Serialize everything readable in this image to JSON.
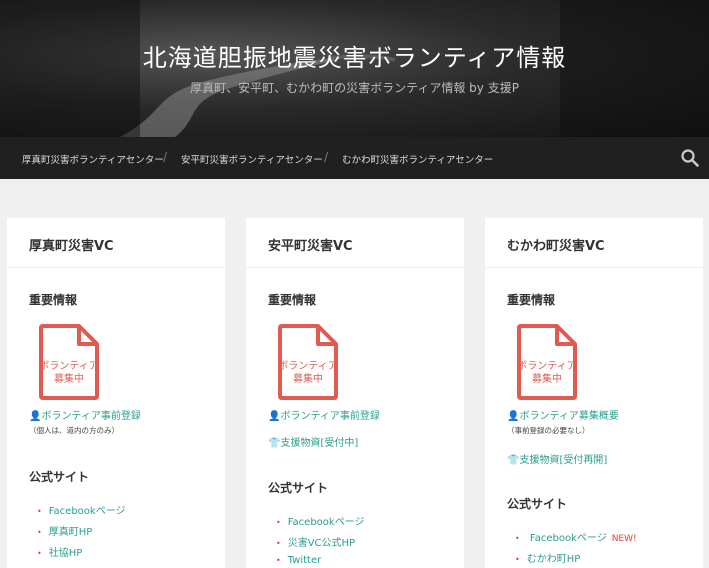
{
  "site": {
    "title": "北海道胆振地震災害ボランティア情報",
    "subtitle": "厚真町、安平町、むかわ町の災害ボランティア情報 by 支援P"
  },
  "nav": {
    "items": [
      "厚真町災害ボランティアセンター",
      "安平町災害ボランティアセンター",
      "むかわ町災害ボランティアセンター"
    ],
    "separator": "/"
  },
  "doc_icon_text": [
    "ボランティア",
    "募集中"
  ],
  "cards": [
    {
      "title": "厚真町災害VC",
      "important_heading": "重要情報",
      "register_link": "ボランティア事前登録",
      "register_note": "（個人は、道内の方のみ）",
      "official_heading": "公式サイト",
      "links": [
        "Facebookページ",
        "厚真町HP",
        "社協HP"
      ]
    },
    {
      "title": "安平町災害VC",
      "important_heading": "重要情報",
      "register_link": "ボランティア事前登録",
      "supplies_link": "支援物資[受付中]",
      "official_heading": "公式サイト",
      "links": [
        "Facebookページ",
        "災害VC公式HP",
        "Twitter"
      ]
    },
    {
      "title": "むかわ町災害VC",
      "important_heading": "重要情報",
      "register_link": "ボランティア募集概要",
      "register_note": "（事前登録の必要なし）",
      "supplies_link": "支援物資[受付再開]",
      "official_heading": "公式サイト",
      "links": [
        "Facebookページ",
        "むかわ町HP"
      ],
      "new_badge": "NEW!"
    }
  ],
  "colors": {
    "accent": "#2a9d8f",
    "doc_icon": "#e05a50",
    "badge": "#e04030",
    "navbar": "#202020"
  }
}
